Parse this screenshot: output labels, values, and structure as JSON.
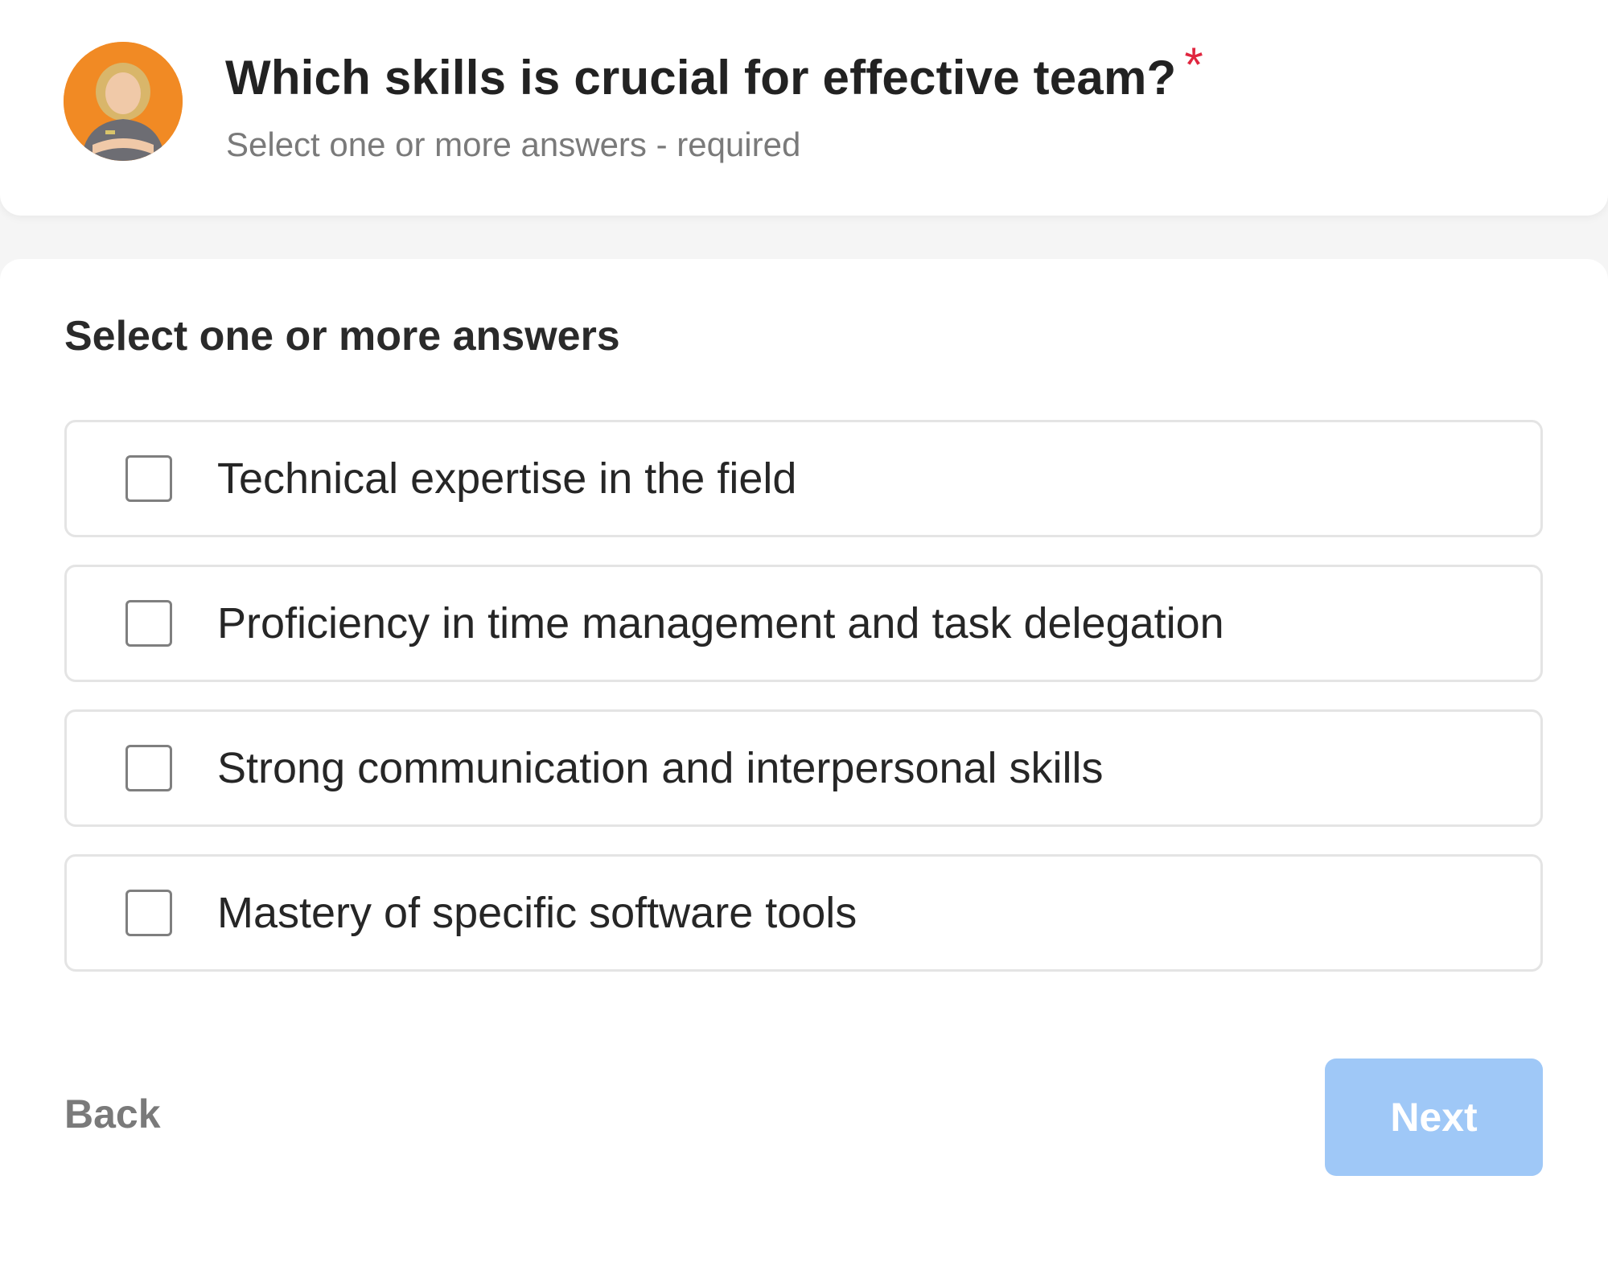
{
  "header": {
    "title": "Which skills is crucial for effective team?",
    "required_marker": "*",
    "subtitle": "Select one or more answers - required",
    "avatar_icon": "user-avatar-photo"
  },
  "form": {
    "instructions": "Select one or more answers",
    "options": [
      {
        "label": "Technical expertise in the field",
        "checked": false
      },
      {
        "label": "Proficiency in time management and task delegation",
        "checked": false
      },
      {
        "label": "Strong communication and interpersonal skills",
        "checked": false
      },
      {
        "label": "Mastery of specific software tools",
        "checked": false
      }
    ]
  },
  "footer": {
    "back_label": "Back",
    "next_label": "Next",
    "next_enabled": false
  },
  "colors": {
    "required_star": "#e0263f",
    "next_disabled_bg": "#9fc8f7",
    "avatar_bg": "#f18a24"
  }
}
